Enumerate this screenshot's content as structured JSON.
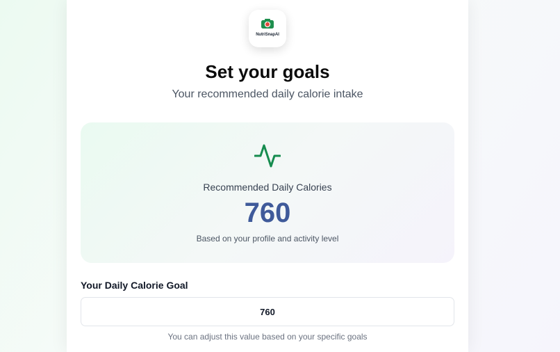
{
  "brand": {
    "logo_text": "NutriSnapAI",
    "logo_icon": "camera-icon",
    "accent_color": "#16a34a"
  },
  "header": {
    "title": "Set your goals",
    "subtitle": "Your recommended daily calorie intake"
  },
  "recommendation": {
    "icon": "activity-pulse-icon",
    "label": "Recommended Daily Calories",
    "value": "760",
    "note": "Based on your profile and activity level",
    "value_color": "#3f5a9a"
  },
  "goal": {
    "label": "Your Daily Calorie Goal",
    "value": "760",
    "hint": "You can adjust this value based on your specific goals"
  }
}
